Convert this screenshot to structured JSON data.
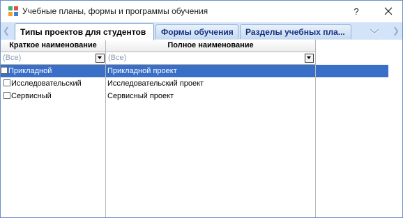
{
  "window": {
    "title": "Учебные планы, формы и программы обучения",
    "help_label": "?"
  },
  "tabs": [
    {
      "label": "Типы проектов для студентов",
      "active": true
    },
    {
      "label": "Формы обучения",
      "active": false
    },
    {
      "label": "Разделы учебных пла...",
      "active": false
    }
  ],
  "grid": {
    "columns": [
      {
        "header": "Краткое наименование",
        "filter": "(Все)"
      },
      {
        "header": "Полное наименование",
        "filter": "(Все)"
      }
    ],
    "rows": [
      {
        "short": "Прикладной",
        "full": "Прикладной проект",
        "selected": true
      },
      {
        "short": "Исследовательский",
        "full": "Исследовательский проект",
        "selected": false
      },
      {
        "short": "Сервисный",
        "full": "Сервисный проект",
        "selected": false
      }
    ]
  },
  "colors": {
    "selection": "#3a6fc8",
    "tab_text": "#15317d",
    "tabstrip_bg": "#d4e4f8"
  }
}
